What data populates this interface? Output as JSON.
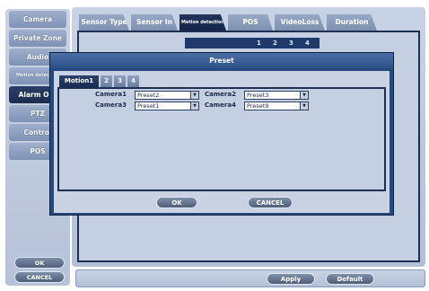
{
  "sidebar": {
    "items": [
      {
        "label": "Camera",
        "active": false
      },
      {
        "label": "Private Zone",
        "active": false
      },
      {
        "label": "Audio",
        "active": false
      },
      {
        "label": "Motion detection",
        "active": false
      },
      {
        "label": "Alarm Out",
        "active": true
      },
      {
        "label": "PTZ",
        "active": false
      },
      {
        "label": "Control",
        "active": false
      },
      {
        "label": "POS",
        "active": false
      }
    ],
    "ok_label": "OK",
    "cancel_label": "CANCEL"
  },
  "main": {
    "tabs": [
      {
        "label": "Sensor Type"
      },
      {
        "label": "Sensor In"
      },
      {
        "label": "Motion detection"
      },
      {
        "label": "POS"
      },
      {
        "label": "VideoLoss"
      },
      {
        "label": "Duration"
      }
    ],
    "numbers": [
      "1",
      "2",
      "3",
      "4"
    ]
  },
  "bottom": {
    "apply_label": "Apply",
    "default_label": "Default"
  },
  "dialog": {
    "title": "Preset",
    "tabs": [
      "Motion1",
      "2",
      "3",
      "4"
    ],
    "cameras": [
      {
        "label": "Camera1",
        "value": "Preset2"
      },
      {
        "label": "Camera2",
        "value": "Preset3"
      },
      {
        "label": "Camera3",
        "value": "Preset1"
      },
      {
        "label": "Camera4",
        "value": "Preset9"
      }
    ],
    "ok_label": "OK",
    "cancel_label": "CANCEL"
  },
  "colors": {
    "panel": "#c4cfe2",
    "dialog_frame": "#264a7e",
    "active_tab": "#1b2c52"
  }
}
